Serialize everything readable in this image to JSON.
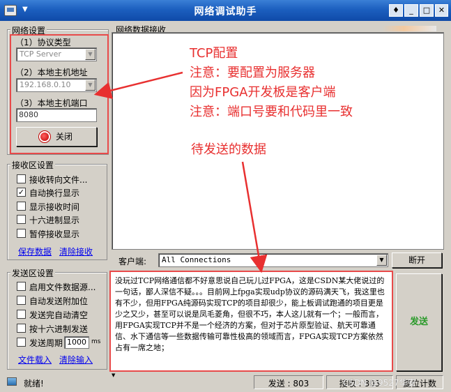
{
  "window": {
    "title": "网络调试助手",
    "menu_arrow": "▼",
    "buttons": {
      "pin": "♦",
      "minimize": "_",
      "maximize": "□",
      "close": "✕"
    }
  },
  "network_settings": {
    "group_label": "网络设置",
    "protocol_label": "（1）协议类型",
    "protocol_value": "TCP Server",
    "host_label": "（2）本地主机地址",
    "host_value": "192.168.0.10",
    "port_label": "（3）本地主机端口",
    "port_value": "8080",
    "close_button": "关闭"
  },
  "receive_settings": {
    "group_label": "接收区设置",
    "options": [
      {
        "label": "接收转向文件...",
        "checked": false
      },
      {
        "label": "自动换行显示",
        "checked": true
      },
      {
        "label": "显示接收时间",
        "checked": false
      },
      {
        "label": "十六进制显示",
        "checked": false
      },
      {
        "label": "暂停接收显示",
        "checked": false
      }
    ],
    "save_link": "保存数据",
    "clear_link": "清除接收"
  },
  "send_settings": {
    "group_label": "发送区设置",
    "options": [
      {
        "label": "启用文件数据源...",
        "checked": false
      },
      {
        "label": "自动发送附加位",
        "checked": false
      },
      {
        "label": "发送完自动清空",
        "checked": false
      },
      {
        "label": "按十六进制发送",
        "checked": false
      },
      {
        "label": "发送周期",
        "checked": false
      }
    ],
    "period_value": "1000",
    "period_unit": "ms",
    "file_link": "文件载入",
    "clear_link": "清除输入"
  },
  "receive_area": {
    "label": "网络数据接收"
  },
  "client": {
    "label": "客户端:",
    "value": "All Connections",
    "disconnect_button": "断开"
  },
  "send_area": {
    "text": "没玩过TCP网络通信都不好意思说自己玩儿过FPGA，这是CSDN某大佬说过的一句话，鄙人深信不疑。。。目前网上fpga实现udp协议的源码满天飞，我这里也有不少，但用FPGA纯源码实现TCP的项目却很少，能上板调试跑通的项目更是少之又少，甚至可以说是凤毛菱角，但很不巧，本人这儿就有一个；一般而言，用FPGA实现TCP并不是一个经济的方案，但对于芯片原型验证、航天可靠通信、水下通信等一些数据传输可靠性极高的领域而言，FPGA实现TCP方案依然占有一席之地；",
    "send_button": "发送"
  },
  "status_bar": {
    "status": "就绪!",
    "sent": "发送 : 803",
    "received": "接收 : 803",
    "reset": "复位计数",
    "watermark": "CSDN @9527华安"
  },
  "annotations": {
    "line1": "TCP配置",
    "line2": "注意：要配置为服务器",
    "line3": "因为FPGA开发板是客户端",
    "line4": "注意：端口号要和代码里一致",
    "line5": "待发送的数据"
  },
  "colors": {
    "title_blue": "#1c5fbf",
    "annotation_red": "#e83030",
    "send_green": "#2a9a2a"
  }
}
